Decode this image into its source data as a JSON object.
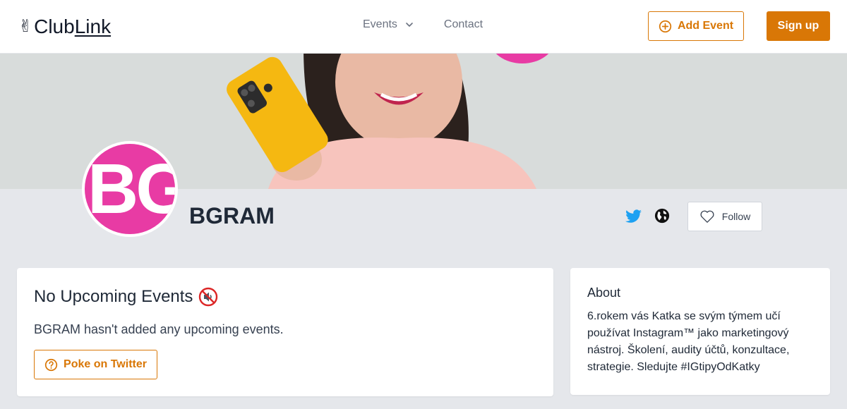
{
  "header": {
    "logo_hand": "✌",
    "logo_part1": "Club",
    "logo_part2": "Link",
    "nav": {
      "events_label": "Events",
      "contact_label": "Contact"
    },
    "add_event_label": "Add Event",
    "signup_label": "Sign up"
  },
  "profile": {
    "avatar_text": "BG",
    "name": "BGRAM",
    "follow_label": "Follow"
  },
  "events_card": {
    "title": "No Upcoming Events",
    "message": "BGRAM hasn't added any upcoming events.",
    "poke_label": "Poke on Twitter"
  },
  "about_card": {
    "title": "About",
    "text": "6.rokem vás Katka se svým týmem učí používat Instagram™ jako marketingový nástroj. Školení, audity účtů, konzultace, strategie. Sledujte #IGtipyOdKatky"
  },
  "colors": {
    "accent": "#d97706",
    "avatar_bg": "#e83ba4",
    "twitter": "#1da1f2",
    "page_bg": "#e5e7eb"
  },
  "icons": {
    "logo": "victory-hand-icon",
    "events_dropdown": "chevron-down-icon",
    "add_event": "plus-circle-icon",
    "twitter": "twitter-icon",
    "website": "globe-icon",
    "follow": "heart-icon",
    "no_events": "muted-speaker-icon",
    "poke": "question-circle-icon"
  }
}
